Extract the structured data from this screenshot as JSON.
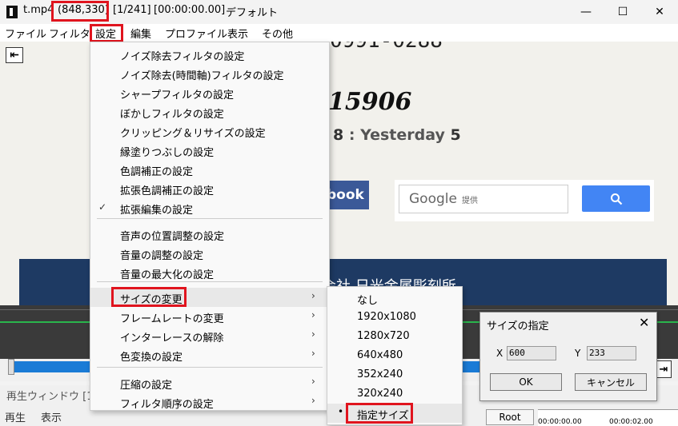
{
  "titlebar": {
    "filename": "t.mp4",
    "cursor_position": "(848,330)",
    "frame": "[1/241]",
    "time": "[00:00:00.00]",
    "profile": "デフォルト",
    "minimize": "—",
    "maximize": "☐",
    "close": "✕"
  },
  "menubar": {
    "file": "ファイル",
    "filter": "フィルタ",
    "settings": "設定",
    "edit": "編集",
    "profile": "プロファイル",
    "view": "表示",
    "other": "その他"
  },
  "content": {
    "back": "⇤",
    "phone": "0991-0288",
    "big_number": "15906",
    "counter_today_value": "8",
    "counter_yesterday_label": ": Yesterday",
    "counter_yesterday_value": "5",
    "facebook_label": "book",
    "google_label": "Google",
    "google_sub": "提供",
    "banner_text": "会社 日光金属彫刻所"
  },
  "settings_menu": {
    "items": [
      {
        "label": "ノイズ除去フィルタの設定"
      },
      {
        "label": "ノイズ除去(時間軸)フィルタの設定"
      },
      {
        "label": "シャープフィルタの設定"
      },
      {
        "label": "ぼかしフィルタの設定"
      },
      {
        "label": "クリッピング＆リサイズの設定"
      },
      {
        "label": "縁塗りつぶしの設定"
      },
      {
        "label": "色調補正の設定"
      },
      {
        "label": "拡張色調補正の設定"
      },
      {
        "label": "拡張編集の設定",
        "check": "✓"
      },
      {
        "label": "音声の位置調整の設定"
      },
      {
        "label": "音量の調整の設定"
      },
      {
        "label": "音量の最大化の設定"
      },
      {
        "label": "サイズの変更",
        "arrow": "›"
      },
      {
        "label": "フレームレートの変更",
        "arrow": "›"
      },
      {
        "label": "インターレースの解除",
        "arrow": "›"
      },
      {
        "label": "色変換の設定",
        "arrow": "›"
      },
      {
        "label": "圧縮の設定",
        "arrow": "›"
      },
      {
        "label": "フィルタ順序の設定",
        "arrow": "›"
      }
    ]
  },
  "size_submenu": {
    "items": [
      {
        "label": "なし"
      },
      {
        "label": "1920x1080"
      },
      {
        "label": "1280x720"
      },
      {
        "label": "640x480"
      },
      {
        "label": "352x240"
      },
      {
        "label": "320x240"
      },
      {
        "label": "指定サイズ",
        "bullet": "•"
      }
    ]
  },
  "size_dialog": {
    "title": "サイズの指定",
    "close": "✕",
    "x_label": "X",
    "x_value": "600",
    "y_label": "Y",
    "y_value": "233",
    "ok": "OK",
    "cancel": "キャンセル"
  },
  "playback": {
    "end_button": "⇥",
    "window_title": "再生ウィンドウ [1",
    "menu_play": "再生",
    "menu_view": "表示",
    "root": "Root",
    "ruler_start": "00:00:00.00",
    "ruler_next": "00:00:02.00"
  },
  "colors": {
    "highlight": "#e0141e",
    "seek_bar": "#1a7bd6",
    "timeline_green": "#2ab54c",
    "banner": "#1e3a63",
    "facebook": "#3b5998",
    "google_button": "#4285f4"
  }
}
